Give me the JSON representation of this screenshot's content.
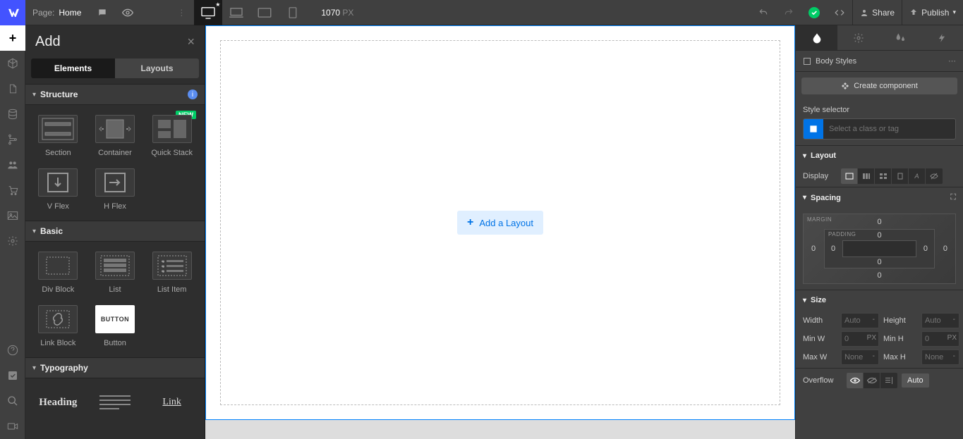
{
  "topbar": {
    "page_label": "Page:",
    "page_name": "Home",
    "px_value": "1070",
    "px_unit": "PX",
    "share": "Share",
    "publish": "Publish"
  },
  "leftrail": {
    "items": [
      "add",
      "box",
      "page",
      "db",
      "nav",
      "users",
      "cart",
      "image",
      "gear"
    ],
    "bottom": [
      "help",
      "check",
      "search",
      "video"
    ]
  },
  "add_panel": {
    "title": "Add",
    "tabs": {
      "elements": "Elements",
      "layouts": "Layouts"
    },
    "sections": {
      "structure": "Structure",
      "basic": "Basic",
      "typography": "Typography"
    },
    "structure_items": [
      {
        "name": "Section"
      },
      {
        "name": "Container"
      },
      {
        "name": "Quick Stack",
        "badge": "NEW"
      },
      {
        "name": "V Flex"
      },
      {
        "name": "H Flex"
      }
    ],
    "basic_items": [
      {
        "name": "Div Block"
      },
      {
        "name": "List"
      },
      {
        "name": "List Item"
      },
      {
        "name": "Link Block"
      },
      {
        "name": "Button"
      }
    ],
    "typography_items": [
      {
        "name": "Heading"
      },
      {
        "name": "Paragraph"
      },
      {
        "name": "Link"
      }
    ]
  },
  "canvas": {
    "add_layout": "Add a Layout"
  },
  "rpanel": {
    "selector": "Body Styles",
    "create_component": "Create component",
    "style_selector_lbl": "Style selector",
    "style_placeholder": "Select a class or tag",
    "layout": "Layout",
    "display": "Display",
    "spacing": "Spacing",
    "margin": "MARGIN",
    "padding": "PADDING",
    "margin_top": "0",
    "margin_right": "0",
    "margin_bottom": "0",
    "margin_left": "0",
    "padding_top": "0",
    "padding_right": "0",
    "padding_bottom": "0",
    "padding_left": "0",
    "size": "Size",
    "width": "Width",
    "width_val": "Auto",
    "height": "Height",
    "height_val": "Auto",
    "minw": "Min W",
    "minw_val": "0",
    "minw_unit": "PX",
    "minh": "Min H",
    "minh_val": "0",
    "minh_unit": "PX",
    "maxw": "Max W",
    "maxw_val": "None",
    "maxh": "Max H",
    "maxh_val": "None",
    "overflow": "Overflow",
    "overflow_auto": "Auto"
  }
}
